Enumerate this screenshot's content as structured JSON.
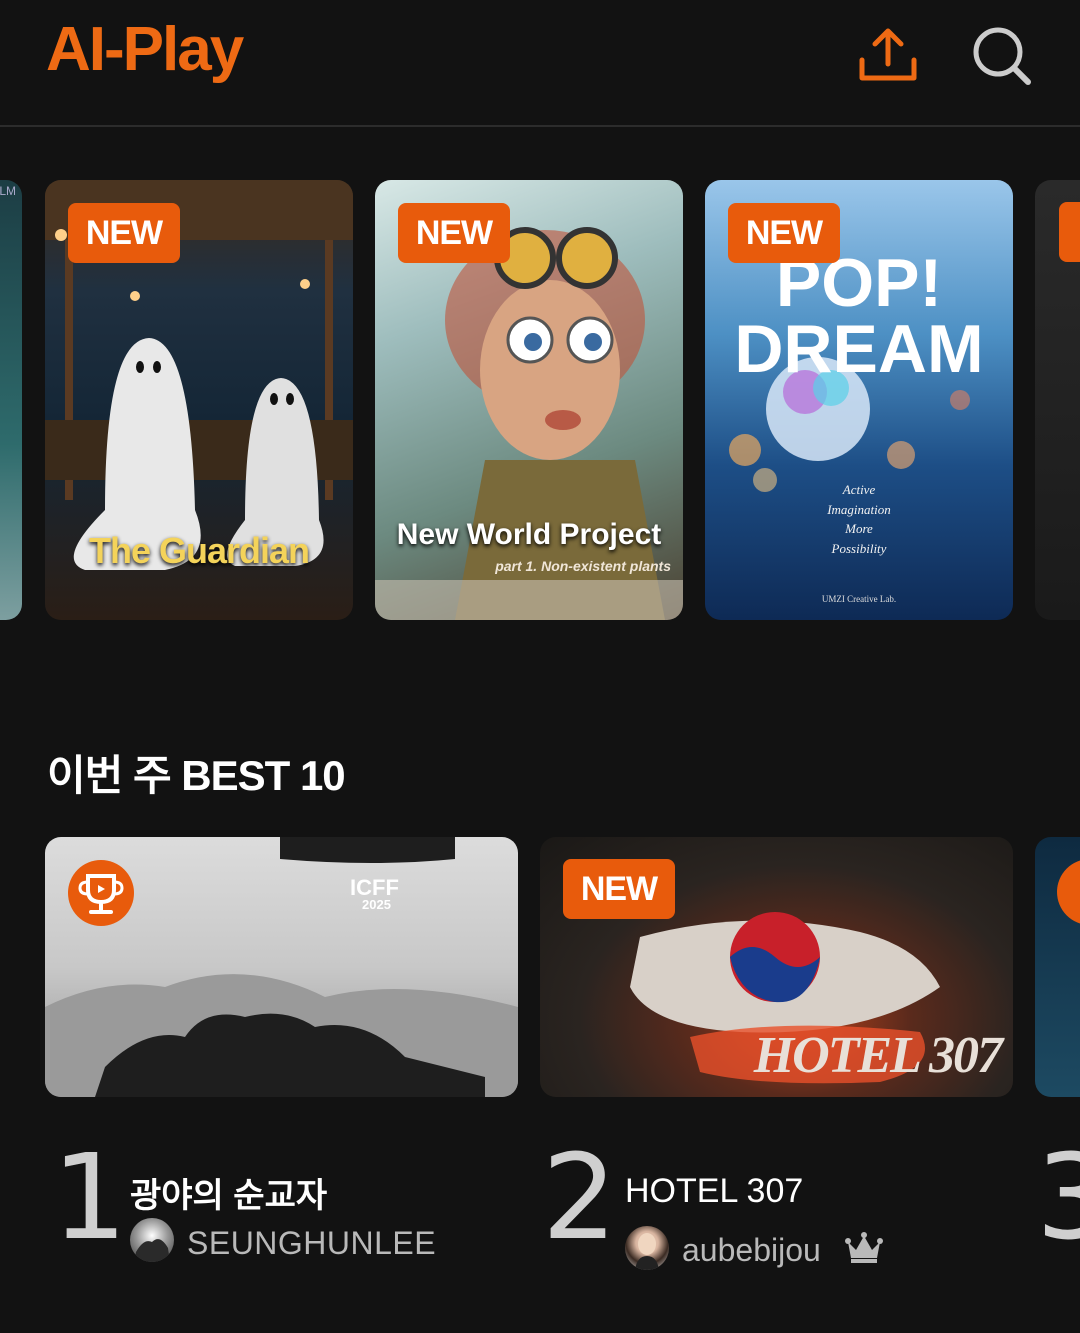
{
  "app": {
    "logo": "AI-Play"
  },
  "header": {
    "upload_icon": "upload-icon",
    "search_icon": "search-icon"
  },
  "carousel": {
    "left_peek_text": "LM",
    "items": [
      {
        "badge": "NEW",
        "title": "The Guardian"
      },
      {
        "badge": "NEW",
        "title": "New World Project",
        "subtitle": "part 1. Non-existent plants"
      },
      {
        "badge": "NEW",
        "title_line1": "POP!",
        "title_line2": "DREAM",
        "subtitle": "Active\nImagination\nMore\nPossibility",
        "credit": "UMZI Creative Lab."
      }
    ]
  },
  "section": {
    "title": "이번 주 BEST 10"
  },
  "best": [
    {
      "rank": "1",
      "title": "광야의 순교자",
      "author": "SEUNGHUNLEE",
      "art_text": "ICFF",
      "art_year": "2025",
      "has_trophy": true
    },
    {
      "rank": "2",
      "title": "HOTEL 307",
      "author": "aubebijou",
      "badge": "NEW",
      "art_text": "HOTEL 307",
      "has_crown": true
    },
    {
      "rank": "3"
    }
  ],
  "colors": {
    "accent": "#e85b0c",
    "background": "#121212"
  }
}
